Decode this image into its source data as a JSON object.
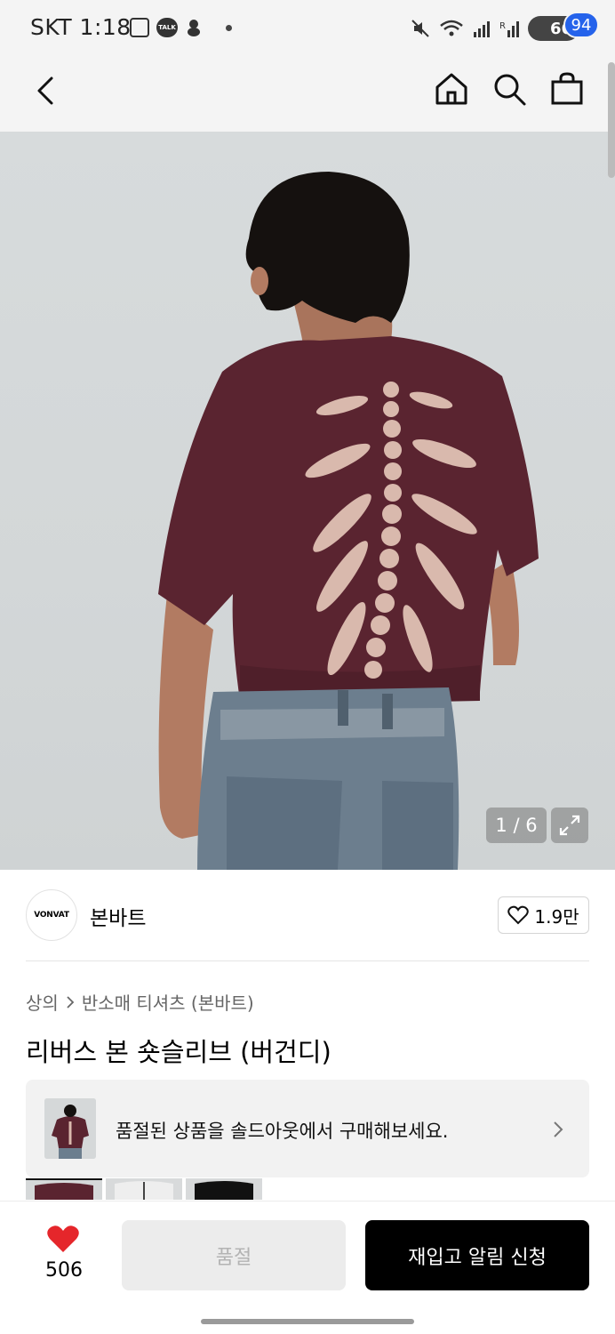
{
  "status_bar": {
    "carrier_time": "SKT 1:18",
    "talk_label": "TALK",
    "battery": "66"
  },
  "header": {
    "cart_count": "94"
  },
  "gallery": {
    "counter": "1 / 6"
  },
  "brand": {
    "logo_text": "VONVAT",
    "name": "본바트",
    "like_count": "1.9만"
  },
  "breadcrumb": {
    "category": "상의",
    "subcategory": "반소매 티셔츠 (본바트)"
  },
  "product": {
    "title": "리버스 본 숏슬리브 (버건디)"
  },
  "soldout_banner": {
    "message": "품절된 상품을 솔드아웃에서 구매해보세요."
  },
  "bottom_bar": {
    "like_count": "506",
    "soldout_label": "품절",
    "restock_label": "재입고 알림 신청"
  },
  "colors": {
    "accent_badge": "#2563eb",
    "heart": "#e5262b",
    "shirt": "#5a2430"
  }
}
